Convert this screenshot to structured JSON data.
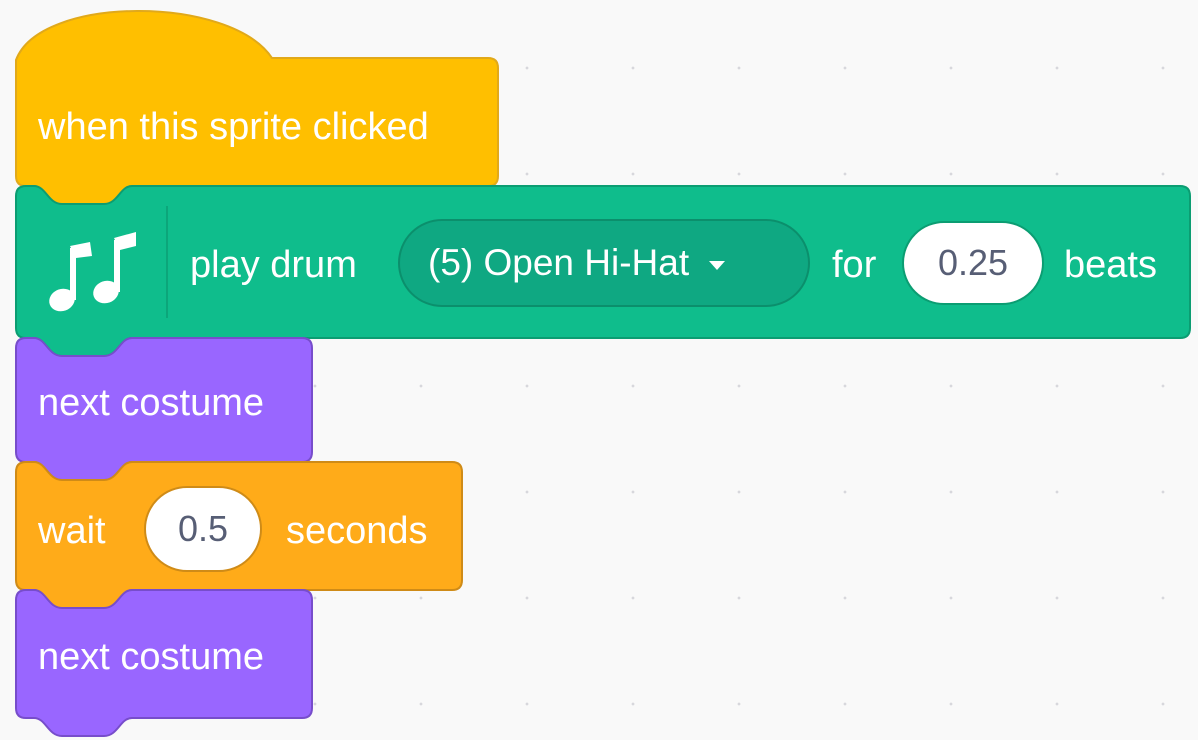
{
  "script": {
    "hat_block": {
      "label": "when this sprite clicked",
      "color": "#ffbf00"
    },
    "drum_block": {
      "extension_icon": "music-notes-icon",
      "label_play": "play drum",
      "drum_selected": "(5) Open Hi-Hat",
      "label_for": "for",
      "beats_value": "0.25",
      "label_beats": "beats",
      "color": "#0fbd8c"
    },
    "costume_block_1": {
      "label": "next costume",
      "color": "#9966ff"
    },
    "wait_block": {
      "label_wait": "wait",
      "seconds_value": "0.5",
      "label_seconds": "seconds",
      "color": "#ffab19"
    },
    "costume_block_2": {
      "label": "next costume",
      "color": "#9966ff"
    }
  }
}
